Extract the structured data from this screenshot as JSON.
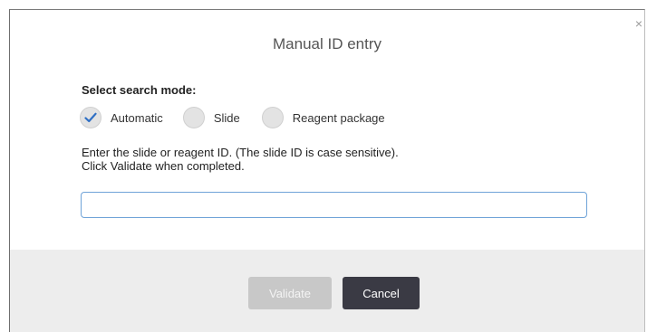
{
  "dialog": {
    "title": "Manual ID entry",
    "close_glyph": "×",
    "close_icon": "close-icon"
  },
  "search_mode": {
    "label": "Select search mode:",
    "options": [
      {
        "label": "Automatic",
        "selected": true,
        "icon": "checkmark-icon"
      },
      {
        "label": "Slide",
        "selected": false
      },
      {
        "label": "Reagent package",
        "selected": false
      }
    ]
  },
  "instructions": {
    "line1": "Enter the slide or reagent ID. (The slide ID is case sensitive).",
    "line2": "Click Validate when completed."
  },
  "id_input": {
    "value": "",
    "placeholder": ""
  },
  "buttons": {
    "validate_label": "Validate",
    "validate_enabled": false,
    "cancel_label": "Cancel"
  },
  "colors": {
    "accent_check": "#2f6fc4",
    "input_border": "#6fa3d8",
    "cancel_bg": "#3a3a44",
    "validate_disabled_bg": "#c8c8c8",
    "footer_bg": "#ededed"
  }
}
